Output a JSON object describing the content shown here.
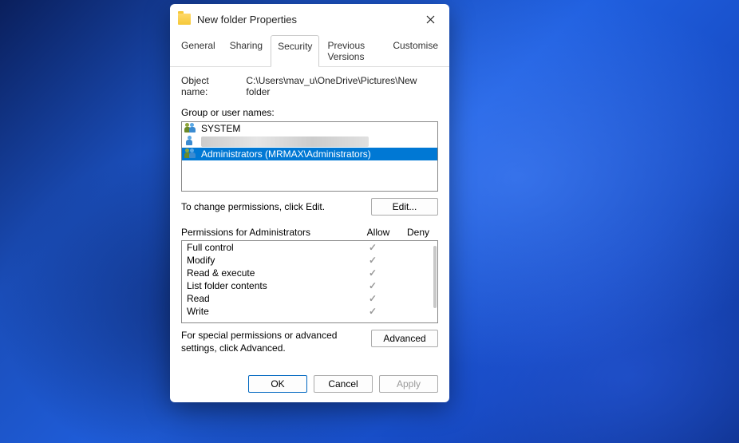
{
  "dialog": {
    "title": "New folder Properties",
    "tabs": [
      "General",
      "Sharing",
      "Security",
      "Previous Versions",
      "Customise"
    ],
    "active_tab": "Security",
    "object_name_label": "Object name:",
    "object_name_value": "C:\\Users\\mav_u\\OneDrive\\Pictures\\New folder",
    "group_users_label": "Group or user names:",
    "users": [
      {
        "name": "SYSTEM",
        "selected": false,
        "blurred": false
      },
      {
        "name": "",
        "selected": false,
        "blurred": true
      },
      {
        "name": "Administrators (MRMAX\\Administrators)",
        "selected": true,
        "blurred": false
      }
    ],
    "edit_hint": "To change permissions, click Edit.",
    "edit_button": "Edit...",
    "permissions_label": "Permissions for Administrators",
    "perm_cols": {
      "allow": "Allow",
      "deny": "Deny"
    },
    "permissions": [
      {
        "name": "Full control",
        "allow": true,
        "deny": false
      },
      {
        "name": "Modify",
        "allow": true,
        "deny": false
      },
      {
        "name": "Read & execute",
        "allow": true,
        "deny": false
      },
      {
        "name": "List folder contents",
        "allow": true,
        "deny": false
      },
      {
        "name": "Read",
        "allow": true,
        "deny": false
      },
      {
        "name": "Write",
        "allow": true,
        "deny": false
      }
    ],
    "advanced_hint": "For special permissions or advanced settings, click Advanced.",
    "advanced_button": "Advanced",
    "footer": {
      "ok": "OK",
      "cancel": "Cancel",
      "apply": "Apply"
    }
  }
}
